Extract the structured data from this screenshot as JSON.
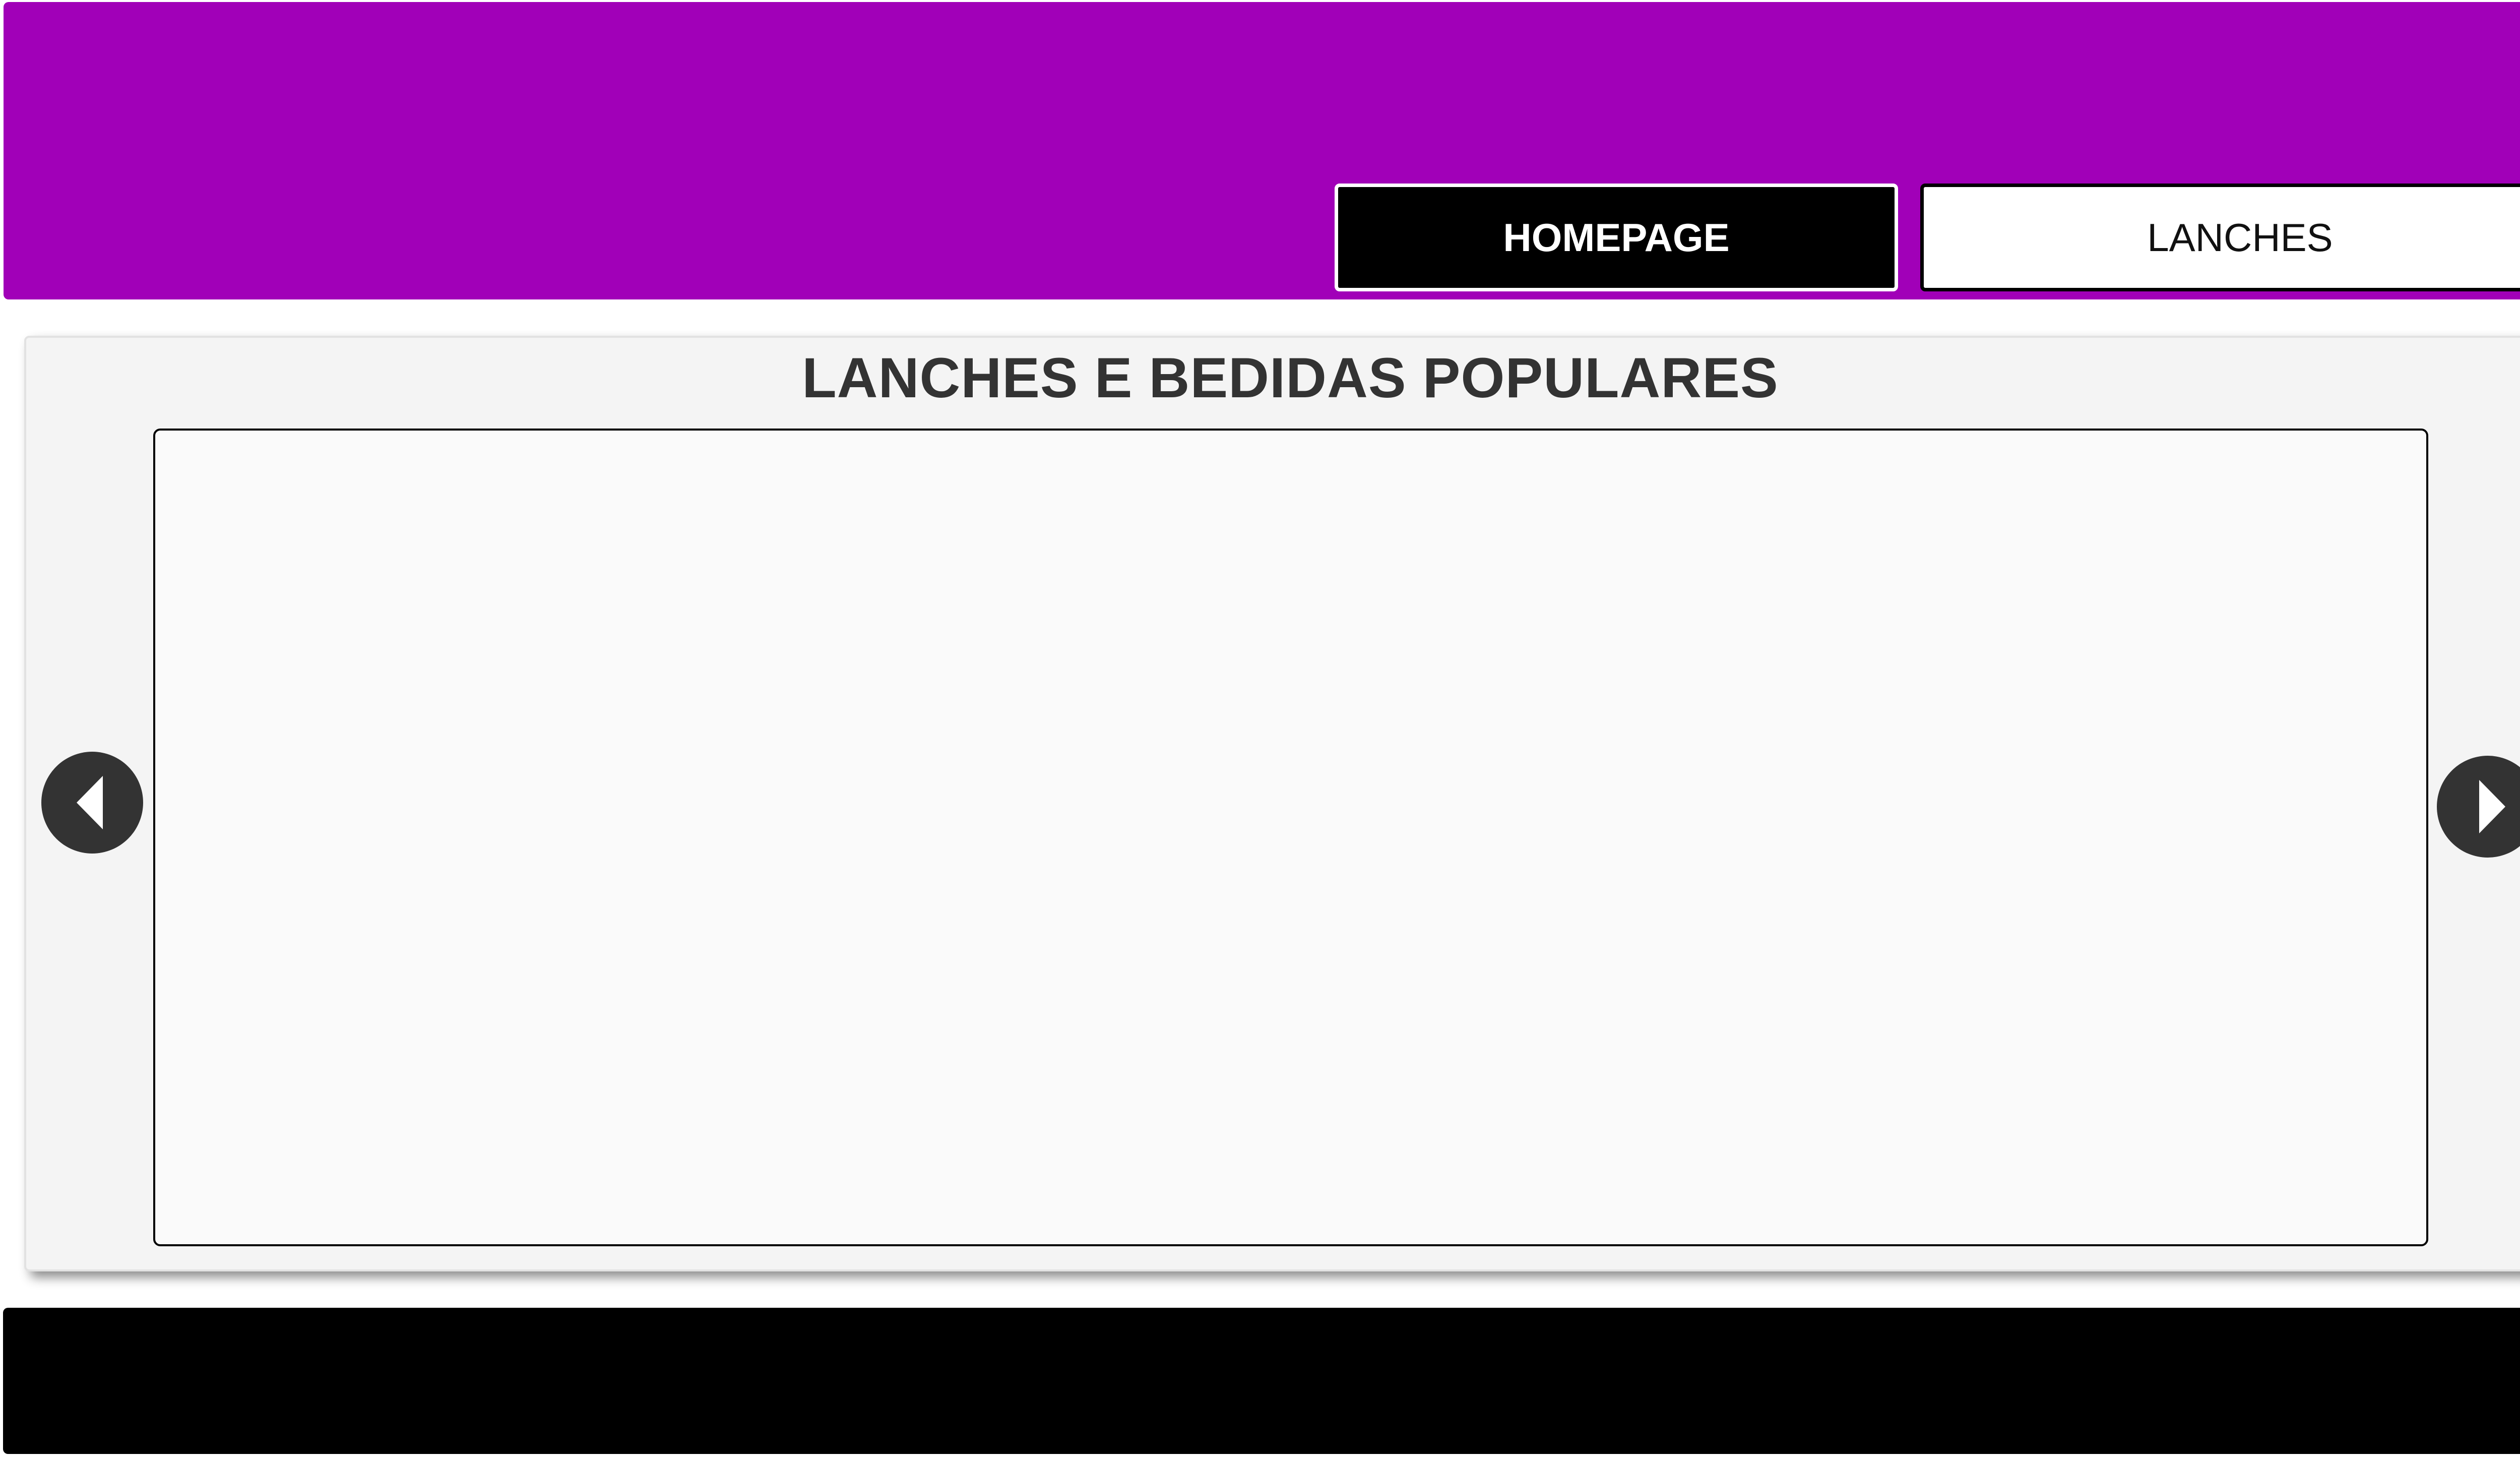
{
  "header": {
    "bg_color": "#a100b8",
    "nav": {
      "homepage_label": "HOMEPAGE",
      "lanches_label": "LANCHES"
    }
  },
  "main": {
    "title": "LANCHES E BEDIDAS POPULARES",
    "carousel": {
      "prev_icon": "chevron-left-icon",
      "next_icon": "chevron-right-icon"
    }
  },
  "footer": {
    "bg_color": "#000000"
  }
}
